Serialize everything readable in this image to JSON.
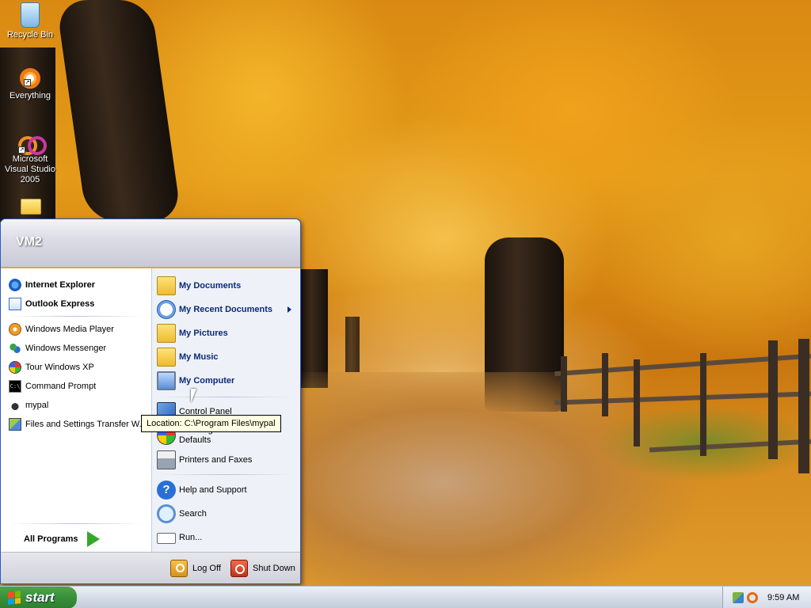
{
  "desktop": {
    "icons": [
      {
        "label": "Recycle Bin"
      },
      {
        "label": "Everything"
      },
      {
        "label": "Microsoft Visual Studio 2005"
      }
    ]
  },
  "start_menu": {
    "user_name": "VM2",
    "pinned": [
      {
        "label": "Internet Explorer",
        "icon": "internet-explorer-icon"
      },
      {
        "label": "Outlook Express",
        "icon": "outlook-express-icon"
      }
    ],
    "recent": [
      {
        "label": "Windows Media Player",
        "icon": "media-player-icon"
      },
      {
        "label": "Windows Messenger",
        "icon": "messenger-icon"
      },
      {
        "label": "Tour Windows XP",
        "icon": "tour-icon"
      },
      {
        "label": "Command Prompt",
        "icon": "command-prompt-icon"
      },
      {
        "label": "mypal",
        "icon": "mypal-icon"
      },
      {
        "label": "Files and Settings Transfer W...",
        "icon": "transfer-wizard-icon"
      }
    ],
    "all_programs_label": "All Programs",
    "places": [
      {
        "label": "My Documents"
      },
      {
        "label": "My Recent Documents"
      },
      {
        "label": "My Pictures"
      },
      {
        "label": "My Music"
      },
      {
        "label": "My Computer"
      }
    ],
    "system": [
      {
        "label": "Control Panel"
      },
      {
        "label": "Set Program Access and Defaults"
      },
      {
        "label": "Printers and Faxes"
      }
    ],
    "help": [
      {
        "label": "Help and Support"
      },
      {
        "label": "Search"
      },
      {
        "label": "Run..."
      }
    ],
    "footer": {
      "log_off": "Log Off",
      "shut_down": "Shut Down"
    }
  },
  "tooltip": "Location: C:\\Program Files\\mypal",
  "taskbar": {
    "start_label": "start",
    "clock": "9:59 AM"
  }
}
